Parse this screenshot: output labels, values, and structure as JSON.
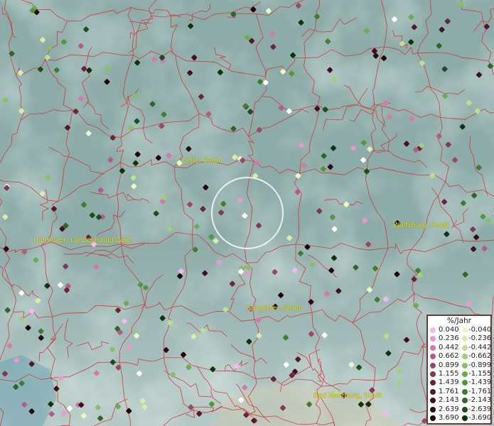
{
  "cities": [
    {
      "id": "celle",
      "name": "Celle, Stadt"
    },
    {
      "id": "hannover",
      "name": "Hannover, Landeshauptstadt"
    },
    {
      "id": "wolfsburg",
      "name": "Wolfsburg, Stadt"
    },
    {
      "id": "salzgitter",
      "name": "Salzgitter, Stadt"
    },
    {
      "id": "bad-harzburg",
      "name": "Bad Harzburg, Stadt"
    }
  ],
  "legend": {
    "title": "%/Jahr",
    "positive": [
      "0.040",
      "0.236",
      "0.442",
      "0.662",
      "0.899",
      "1.155",
      "1.439",
      "1.761",
      "2.143",
      "2.639",
      "3.690"
    ],
    "negative": [
      "-0.040",
      "-0.236",
      "-0.442",
      "-0.662",
      "-0.899",
      "-1.155",
      "-1.439",
      "-1.761",
      "-2.143",
      "-2.639",
      "-3.690"
    ],
    "positive_colors": [
      "#f4b8ec",
      "#e89ad0",
      "#d07aa8",
      "#b45c84",
      "#9a4866",
      "#82384f",
      "#6a2638",
      "#54182a",
      "#40101d",
      "#2e0a12",
      "#1e0508"
    ],
    "negative_colors": [
      "#ecf7c8",
      "#d6eeaa",
      "#bde090",
      "#9fd07a",
      "#86c066",
      "#6aac52",
      "#52963f",
      "#3f7e30",
      "#2e6624",
      "#1e4e18",
      "#0e3509"
    ]
  }
}
